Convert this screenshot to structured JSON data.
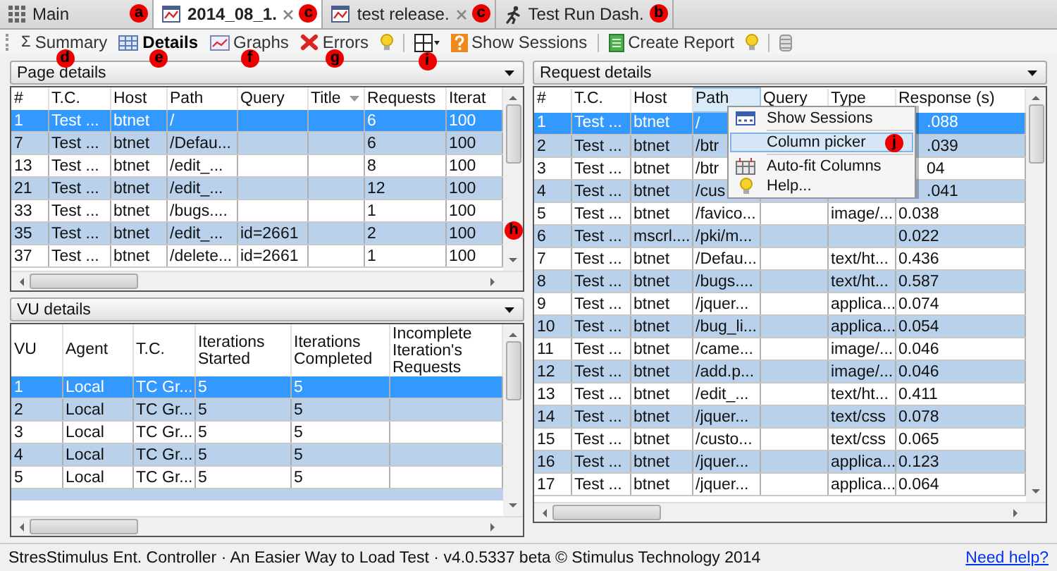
{
  "tabs": [
    {
      "kind": "home",
      "label": "Main",
      "selected": false,
      "closable": false,
      "marker": "a"
    },
    {
      "kind": "document",
      "label": "2014_08_1.",
      "selected": true,
      "closable": true,
      "marker": "c"
    },
    {
      "kind": "document",
      "label": "test release.",
      "selected": false,
      "closable": true,
      "marker": "c"
    },
    {
      "kind": "dashboard",
      "label": "Test Run Dash.",
      "selected": false,
      "closable": false,
      "marker": "b"
    }
  ],
  "toolbar": [
    {
      "kind": "summary",
      "icon_text": "Σ",
      "label": "Summary",
      "selected": false,
      "marker": "d"
    },
    {
      "kind": "details",
      "label": "Details",
      "selected": true,
      "marker": "e"
    },
    {
      "kind": "graphs",
      "label": "Graphs",
      "selected": false,
      "marker": "f"
    },
    {
      "kind": "errors",
      "label": "Errors",
      "selected": false,
      "marker": "g"
    },
    {
      "kind": "hint"
    },
    {
      "kind": "separator"
    },
    {
      "kind": "columns",
      "marker": "i"
    },
    {
      "kind": "sessions",
      "label": "Show Sessions",
      "selected": false
    },
    {
      "kind": "separator"
    },
    {
      "kind": "report",
      "label": "Create Report",
      "selected": false
    },
    {
      "kind": "hint"
    },
    {
      "kind": "separator"
    },
    {
      "kind": "database"
    }
  ],
  "page_details": {
    "title": "Page details",
    "marker": "h",
    "columns": [
      "#",
      "T.C.",
      "Host",
      "Path",
      "Query",
      "Title",
      "Requests",
      "Iterat"
    ],
    "rows": [
      {
        "selected": true,
        "cells": [
          "1",
          "Test ...",
          "btnet",
          "/",
          null,
          null,
          "6",
          "100"
        ]
      },
      {
        "selected": false,
        "cells": [
          "7",
          "Test ...",
          "btnet",
          "/Defau...",
          null,
          null,
          "6",
          "100"
        ]
      },
      {
        "selected": false,
        "cells": [
          "13",
          "Test ...",
          "btnet",
          "/edit_...",
          null,
          null,
          "8",
          "100"
        ]
      },
      {
        "selected": false,
        "cells": [
          "21",
          "Test ...",
          "btnet",
          "/edit_...",
          null,
          null,
          "12",
          "100"
        ]
      },
      {
        "selected": false,
        "cells": [
          "33",
          "Test ...",
          "btnet",
          "/bugs....",
          null,
          null,
          "1",
          "100"
        ]
      },
      {
        "selected": false,
        "cells": [
          "35",
          "Test ...",
          "btnet",
          "/edit_...",
          "id=2661",
          null,
          "2",
          "100"
        ]
      },
      {
        "selected": false,
        "cells": [
          "37",
          "Test ...",
          "btnet",
          "/delete...",
          "id=2661",
          null,
          "1",
          "100"
        ]
      }
    ]
  },
  "vu_details": {
    "title": "VU details",
    "columns": [
      "VU",
      "Agent",
      "T.C.",
      "Iterations Started",
      "Iterations Completed",
      "Incomplete Iteration's Requests"
    ],
    "rows": [
      {
        "selected": true,
        "cells": [
          "1",
          "Local",
          "TC Gr...",
          "5",
          "5",
          null
        ]
      },
      {
        "selected": false,
        "cells": [
          "2",
          "Local",
          "TC Gr...",
          "5",
          "5",
          null
        ]
      },
      {
        "selected": false,
        "cells": [
          "3",
          "Local",
          "TC Gr...",
          "5",
          "5",
          null
        ]
      },
      {
        "selected": false,
        "cells": [
          "4",
          "Local",
          "TC Gr...",
          "5",
          "5",
          null
        ]
      },
      {
        "selected": false,
        "cells": [
          "5",
          "Local",
          "TC Gr...",
          "5",
          "5",
          null
        ]
      }
    ]
  },
  "request_details": {
    "title": "Request details",
    "columns": [
      "#",
      "T.C.",
      "Host",
      "Path",
      "Query",
      "Type",
      "Response (s)"
    ],
    "rows": [
      {
        "selected": true,
        "under_menu": true,
        "cells": [
          "1",
          "Test ...",
          "btnet",
          "/",
          null,
          null,
          ".088"
        ]
      },
      {
        "selected": false,
        "under_menu": true,
        "cells": [
          "2",
          "Test ...",
          "btnet",
          "/btr",
          null,
          null,
          ".039"
        ]
      },
      {
        "selected": false,
        "under_menu": true,
        "cells": [
          "3",
          "Test ...",
          "btnet",
          "/btr",
          null,
          null,
          "04"
        ]
      },
      {
        "selected": false,
        "under_menu": true,
        "cells": [
          "4",
          "Test ...",
          "btnet",
          "/cus",
          null,
          null,
          ".041"
        ]
      },
      {
        "selected": false,
        "under_menu": false,
        "cells": [
          "5",
          "Test ...",
          "btnet",
          "/favico...",
          null,
          "image/...",
          "0.038"
        ]
      },
      {
        "selected": false,
        "under_menu": false,
        "cells": [
          "6",
          "Test ...",
          "mscrl....",
          "/pki/m...",
          null,
          null,
          "0.022"
        ]
      },
      {
        "selected": false,
        "under_menu": false,
        "cells": [
          "7",
          "Test ...",
          "btnet",
          "/Defau...",
          null,
          "text/ht...",
          "0.436"
        ]
      },
      {
        "selected": false,
        "under_menu": false,
        "cells": [
          "8",
          "Test ...",
          "btnet",
          "/bugs....",
          null,
          "text/ht...",
          "0.587"
        ]
      },
      {
        "selected": false,
        "under_menu": false,
        "cells": [
          "9",
          "Test ...",
          "btnet",
          "/jquer...",
          null,
          "applica...",
          "0.074"
        ]
      },
      {
        "selected": false,
        "under_menu": false,
        "cells": [
          "10",
          "Test ...",
          "btnet",
          "/bug_li...",
          null,
          "applica...",
          "0.054"
        ]
      },
      {
        "selected": false,
        "under_menu": false,
        "cells": [
          "11",
          "Test ...",
          "btnet",
          "/came...",
          null,
          "image/...",
          "0.046"
        ]
      },
      {
        "selected": false,
        "under_menu": false,
        "cells": [
          "12",
          "Test ...",
          "btnet",
          "/add.p...",
          null,
          "image/...",
          "0.046"
        ]
      },
      {
        "selected": false,
        "under_menu": false,
        "cells": [
          "13",
          "Test ...",
          "btnet",
          "/edit_...",
          null,
          "text/ht...",
          "0.411"
        ]
      },
      {
        "selected": false,
        "under_menu": false,
        "cells": [
          "14",
          "Test ...",
          "btnet",
          "/jquer...",
          null,
          "text/css",
          "0.078"
        ]
      },
      {
        "selected": false,
        "under_menu": false,
        "cells": [
          "15",
          "Test ...",
          "btnet",
          "/custo...",
          null,
          "text/css",
          "0.065"
        ]
      },
      {
        "selected": false,
        "under_menu": false,
        "cells": [
          "16",
          "Test ...",
          "btnet",
          "/jquer...",
          null,
          "applica...",
          "0.123"
        ]
      },
      {
        "selected": false,
        "under_menu": false,
        "cells": [
          "17",
          "Test ...",
          "btnet",
          "/jquer...",
          null,
          "applica...",
          "0.064"
        ]
      }
    ],
    "context_menu": [
      {
        "kind": "sessions",
        "label": "Show Sessions",
        "selected": false
      },
      {
        "kind": "plain",
        "label": "Column picker",
        "selected": true,
        "marker": "j"
      },
      {
        "kind": "autofit",
        "label": "Auto-fit Columns",
        "selected": false
      },
      {
        "kind": "help",
        "label": "Help...",
        "selected": false
      }
    ]
  },
  "status_bar": {
    "text": "StresStimulus Ent. Controller · An Easier Way to Load Test · v4.0.5337 beta © Stimulus Technology 2014",
    "link": "Need help?"
  }
}
